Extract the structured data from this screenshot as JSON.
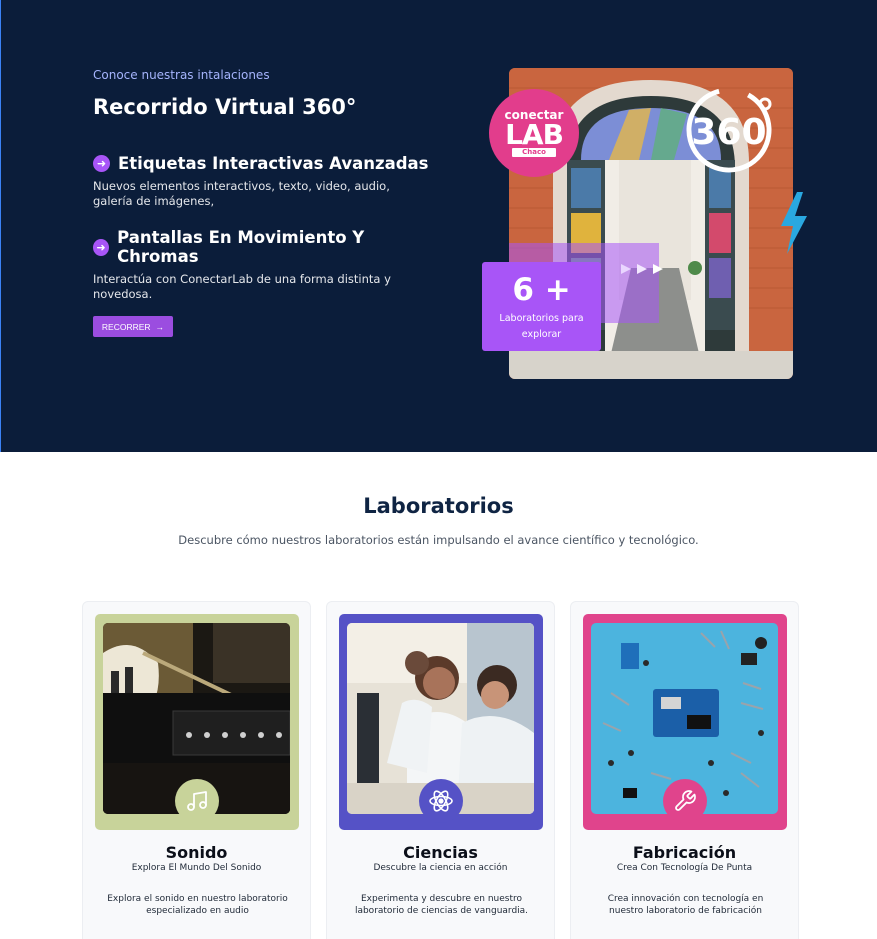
{
  "hero": {
    "eyebrow": "Conoce nuestras intalaciones",
    "title": "Recorrido Virtual 360°",
    "features": [
      {
        "title": "Etiquetas Interactivas Avanzadas",
        "desc": "Nuevos elementos interactivos, texto, video, audio, galería de imágenes,"
      },
      {
        "title": "Pantallas En Movimiento Y Chromas",
        "desc": "Interactúa con ConectarLab de una forma distinta y novedosa."
      }
    ],
    "button_label": "RECORRER",
    "badge": {
      "line1": "conectar",
      "line2": "LAB",
      "line3": "Chaco"
    },
    "tour_badge": "360",
    "counter": {
      "number": "6 +",
      "label": "Laboratorios para explorar"
    },
    "colors": {
      "background": "#0b1d3a",
      "accent": "#a855f7",
      "pink": "#e23d8c",
      "lightning": "#2aa8e0"
    }
  },
  "labs": {
    "title": "Laboratorios",
    "subtitle": "Descubre cómo nuestros laboratorios están impulsando el avance científico y tecnológico.",
    "cards": [
      {
        "title": "Sonido",
        "subtitle": "Explora El Mundo Del Sonido",
        "desc": "Explora el sonido en nuestro laboratorio especializado en audio",
        "icon": "music-note-icon",
        "frame_color": "#c8d39a"
      },
      {
        "title": "Ciencias",
        "subtitle": "Descubre la ciencia en acción",
        "desc": "Experimenta y descubre en nuestro laboratorio de ciencias de vanguardia.",
        "icon": "atom-icon",
        "frame_color": "#5552c6"
      },
      {
        "title": "Fabricación",
        "subtitle": "Crea Con Tecnología De Punta",
        "desc": "Crea innovación con tecnología en nuestro laboratorio de fabricación",
        "icon": "wrench-icon",
        "frame_color": "#e0448c"
      }
    ]
  }
}
